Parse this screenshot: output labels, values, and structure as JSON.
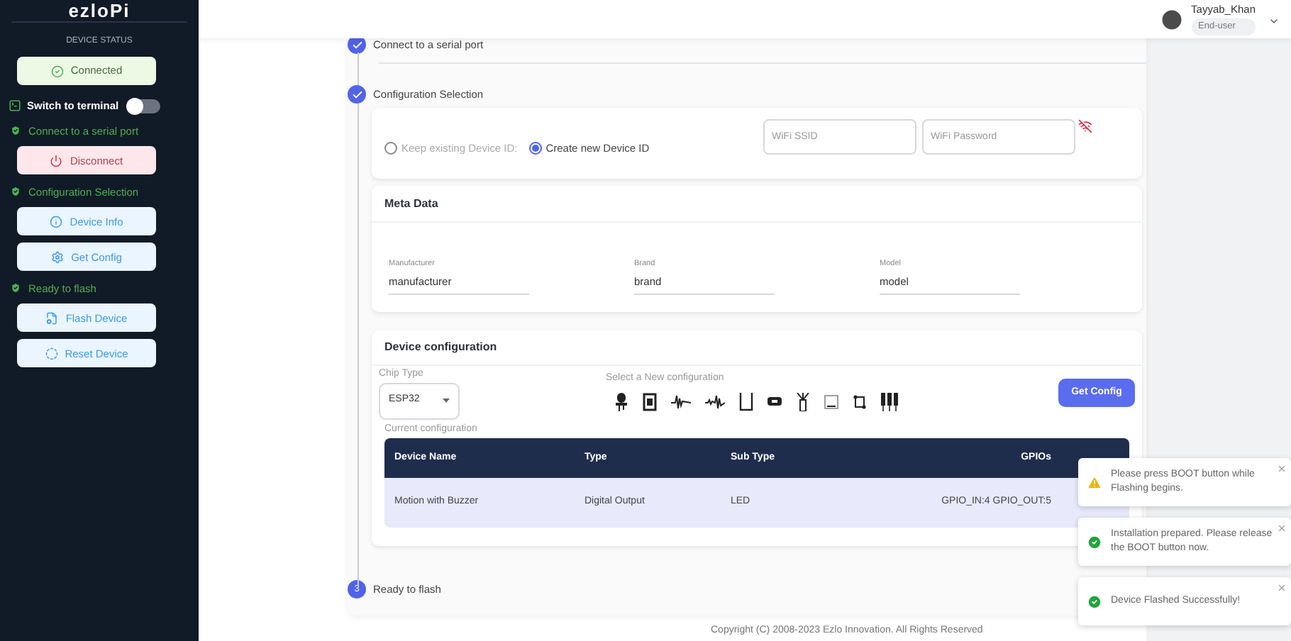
{
  "sidebar": {
    "logo": "ezloPi",
    "status_heading": "DEVICE STATUS",
    "status": {
      "label": "Connected",
      "kind": "success"
    },
    "terminal_toggle": {
      "label": "Switch to terminal",
      "on": false
    },
    "sections": [
      {
        "title": "Connect to a serial port",
        "done": true,
        "buttons": [
          {
            "label": "Disconnect",
            "kind": "danger"
          }
        ]
      },
      {
        "title": "Configuration Selection",
        "done": true,
        "buttons": [
          {
            "label": "Device Info",
            "kind": "info"
          },
          {
            "label": "Get Config",
            "kind": "info"
          }
        ]
      },
      {
        "title": "Ready to flash",
        "done": true,
        "buttons": [
          {
            "label": "Flash Device",
            "kind": "info"
          },
          {
            "label": "Reset Device",
            "kind": "info"
          }
        ]
      }
    ]
  },
  "header": {
    "user_name": "Tayyab_Khan",
    "role": "End-user"
  },
  "steps": [
    {
      "label": "Connect to a serial port",
      "done": true
    },
    {
      "label": "Configuration Selection",
      "done": true
    },
    {
      "label": "Ready to flash",
      "done": false,
      "number": "3"
    }
  ],
  "device_id": {
    "options": [
      {
        "label": "Keep existing Device ID:",
        "selected": false,
        "disabled": true
      },
      {
        "label": "Create new Device ID",
        "selected": true,
        "disabled": false
      }
    ],
    "wifi_ssid": {
      "placeholder": "WiFi SSID"
    },
    "wifi_password": {
      "placeholder": "WiFi Password"
    }
  },
  "meta_data": {
    "title": "Meta Data",
    "fields": [
      {
        "label": "Manufacturer",
        "value": "manufacturer"
      },
      {
        "label": "Brand",
        "value": "brand"
      },
      {
        "label": "Model",
        "value": "model"
      }
    ]
  },
  "device_configuration": {
    "title": "Device configuration",
    "chip_type": {
      "label": "Chip Type",
      "value": "ESP32"
    },
    "new_config_label": "Select a New configuration",
    "get_config_button": "Get Config",
    "current_label": "Current configuration",
    "columns": [
      "Device Name",
      "Type",
      "Sub Type",
      "GPIOs"
    ],
    "rows": [
      {
        "cells": [
          "Motion with Buzzer",
          "Digital Output",
          "LED",
          "GPIO_IN:4 GPIO_OUT:5"
        ]
      }
    ]
  },
  "toasts": [
    {
      "kind": "warning",
      "message": "Please press BOOT button while Flashing begins."
    },
    {
      "kind": "success",
      "message": "Installation prepared. Please release the BOOT button now."
    },
    {
      "kind": "success",
      "message": "Device Flashed Successfully!"
    }
  ],
  "footer": "Copyright (C) 2008-2023 Ezlo Innovation. All Rights Reserved"
}
